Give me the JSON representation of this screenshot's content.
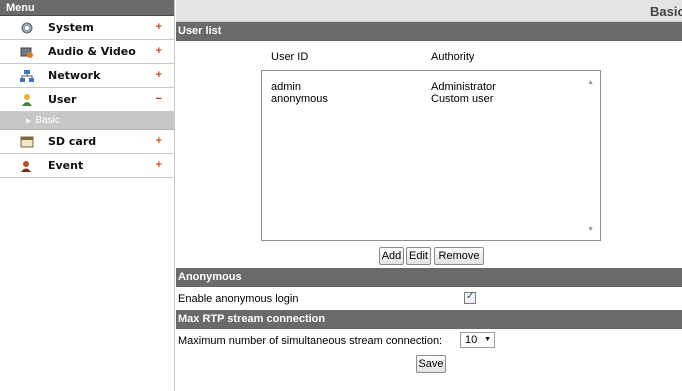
{
  "sidebar": {
    "title": "Menu",
    "items": [
      {
        "label": "System",
        "sign": "+",
        "icon": "gear-icon"
      },
      {
        "label": "Audio & Video",
        "sign": "+",
        "icon": "camera-icon"
      },
      {
        "label": "Network",
        "sign": "+",
        "icon": "network-icon"
      },
      {
        "label": "User",
        "sign": "−",
        "icon": "user-icon"
      },
      {
        "label": "SD card",
        "sign": "+",
        "icon": "sd-card-icon"
      },
      {
        "label": "Event",
        "sign": "+",
        "icon": "event-icon"
      }
    ],
    "submenu": {
      "label": "Basic"
    }
  },
  "main": {
    "title": "Basic",
    "user_list": {
      "header": "User list",
      "col_user_id": "User ID",
      "col_authority": "Authority",
      "rows": [
        {
          "user_id": "admin",
          "authority": "Administrator"
        },
        {
          "user_id": "anonymous",
          "authority": "Custom user"
        }
      ],
      "add_label": "Add",
      "edit_label": "Edit",
      "remove_label": "Remove"
    },
    "anonymous": {
      "header": "Anonymous",
      "enable_label": "Enable anonymous login",
      "checked": true
    },
    "rtp": {
      "header": "Max RTP stream connection",
      "max_label": "Maximum number of simultaneous stream connection:",
      "value": "10"
    },
    "save_label": "Save"
  },
  "colors": {
    "section_header": "#6a6a6a",
    "accent_plus": "#d64b1c",
    "submenu_bg": "#c7c7c7"
  }
}
